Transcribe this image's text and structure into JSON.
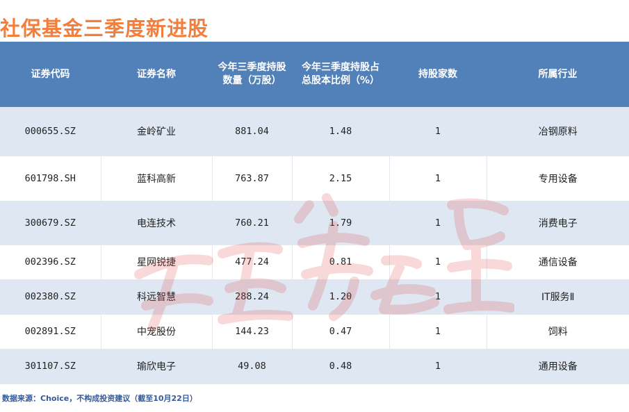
{
  "title": "社保基金三季度新进股",
  "headers": {
    "code": "证券代码",
    "name": "证券名称",
    "quantity_l1": "今年三季度持股",
    "quantity_l2": "数量（万股）",
    "ratio_l1": "今年三季度持股占",
    "ratio_l2": "总股本比例（%）",
    "holders": "持股家数",
    "industry": "所属行业"
  },
  "rows": [
    {
      "code": "000655.SZ",
      "name": "金岭矿业",
      "quantity": "881.04",
      "ratio": "1.48",
      "holders": "1",
      "industry": "冶钢原料"
    },
    {
      "code": "601798.SH",
      "name": "蓝科高新",
      "quantity": "763.87",
      "ratio": "2.15",
      "holders": "1",
      "industry": "专用设备"
    },
    {
      "code": "300679.SZ",
      "name": "电连技术",
      "quantity": "760.21",
      "ratio": "1.79",
      "holders": "1",
      "industry": "消费电子"
    },
    {
      "code": "002396.SZ",
      "name": "星网锐捷",
      "quantity": "477.24",
      "ratio": "0.81",
      "holders": "1",
      "industry": "通信设备"
    },
    {
      "code": "002380.SZ",
      "name": "科远智慧",
      "quantity": "288.24",
      "ratio": "1.20",
      "holders": "1",
      "industry": "IT服务Ⅱ"
    },
    {
      "code": "002891.SZ",
      "name": "中宠股份",
      "quantity": "144.23",
      "ratio": "0.47",
      "holders": "1",
      "industry": "饲料"
    },
    {
      "code": "301107.SZ",
      "name": "瑜欣电子",
      "quantity": "49.08",
      "ratio": "0.48",
      "holders": "1",
      "industry": "通用设备"
    }
  ],
  "footer": "数据来源：Choice，不构成投资建议（截至10月22日）",
  "colors": {
    "title": "#f47f3c",
    "header_bg": "#5280b8",
    "row_alt_bg": "#dfe7f2",
    "footer": "#335a99",
    "watermark": "#e05050"
  }
}
